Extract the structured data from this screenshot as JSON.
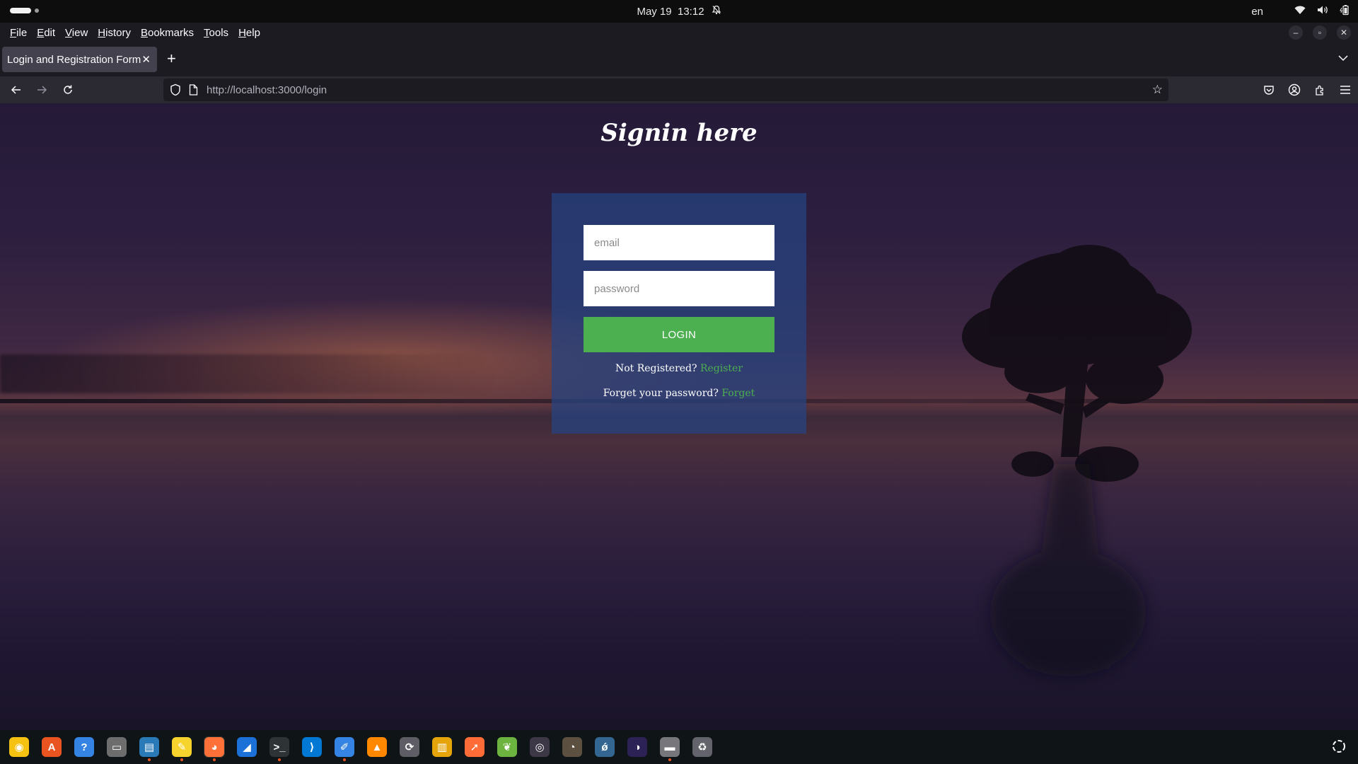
{
  "topbar": {
    "date": "May 19",
    "time": "13:12",
    "language": "en",
    "icons": [
      "notification-off-icon",
      "wifi-icon",
      "volume-icon",
      "battery-icon"
    ]
  },
  "menubar": {
    "items": [
      {
        "label": "File",
        "key": "F",
        "rest": "ile"
      },
      {
        "label": "Edit",
        "key": "E",
        "rest": "dit"
      },
      {
        "label": "View",
        "key": "V",
        "rest": "iew"
      },
      {
        "label": "History",
        "key": "H",
        "rest": "istory"
      },
      {
        "label": "Bookmarks",
        "key": "B",
        "rest": "ookmarks"
      },
      {
        "label": "Tools",
        "key": "T",
        "rest": "ools"
      },
      {
        "label": "Help",
        "key": "H",
        "rest": "elp"
      }
    ]
  },
  "browser": {
    "tab_title": "Login and Registration Form",
    "url_host": "http://localhost",
    "url_rest": ":3000/login"
  },
  "page": {
    "heading": "Signin here",
    "email_placeholder": "email",
    "password_placeholder": "password",
    "login_label": "LOGIN",
    "register_prompt": "Not Registered?",
    "register_link": "Register",
    "forget_prompt": "Forget your password?",
    "forget_link": "Forget"
  },
  "colors": {
    "accent": "#4caf50",
    "card": "#264482",
    "chrome": "#1c1b22"
  },
  "dock": {
    "apps": [
      {
        "name": "rhythmbox-icon",
        "color": "#f5c211",
        "glyph": "◉"
      },
      {
        "name": "app-center-icon",
        "color": "#e95420",
        "glyph": "A"
      },
      {
        "name": "help-icon",
        "color": "#3584e4",
        "glyph": "?"
      },
      {
        "name": "files-icon",
        "color": "#6d6d6d",
        "glyph": "▭"
      },
      {
        "name": "libreoffice-writer-icon",
        "color": "#2a7ab8",
        "glyph": "▤"
      },
      {
        "name": "text-editor-icon",
        "color": "#f6d32d",
        "glyph": "✎"
      },
      {
        "name": "firefox-icon",
        "color": "#ff7139",
        "glyph": "◕"
      },
      {
        "name": "wireshark-icon",
        "color": "#1c71d8",
        "glyph": "◢"
      },
      {
        "name": "terminal-icon",
        "color": "#2e3436",
        "glyph": ">_"
      },
      {
        "name": "vscode-icon",
        "color": "#0078d4",
        "glyph": "⟩"
      },
      {
        "name": "notes-icon",
        "color": "#3584e4",
        "glyph": "✐"
      },
      {
        "name": "vlc-icon",
        "color": "#ff8800",
        "glyph": "▲"
      },
      {
        "name": "software-updater-icon",
        "color": "#5e5c64",
        "glyph": "⟳"
      },
      {
        "name": "archive-manager-icon",
        "color": "#e5a50a",
        "glyph": "▥"
      },
      {
        "name": "postman-icon",
        "color": "#ff6c37",
        "glyph": "➚"
      },
      {
        "name": "spring-tool-icon",
        "color": "#6db33f",
        "glyph": "❦"
      },
      {
        "name": "obs-icon",
        "color": "#3d3846",
        "glyph": "◎"
      },
      {
        "name": "gimp-icon",
        "color": "#5c5040",
        "glyph": "◔"
      },
      {
        "name": "postgresql-icon",
        "color": "#336791",
        "glyph": "ǿ"
      },
      {
        "name": "eclipse-icon",
        "color": "#2c2255",
        "glyph": "◑"
      },
      {
        "name": "ssd-icon",
        "color": "#77767b",
        "glyph": "▬"
      },
      {
        "name": "trash-icon",
        "color": "#63636b",
        "glyph": "♻"
      }
    ],
    "grid_icon": "show-apps-icon"
  }
}
